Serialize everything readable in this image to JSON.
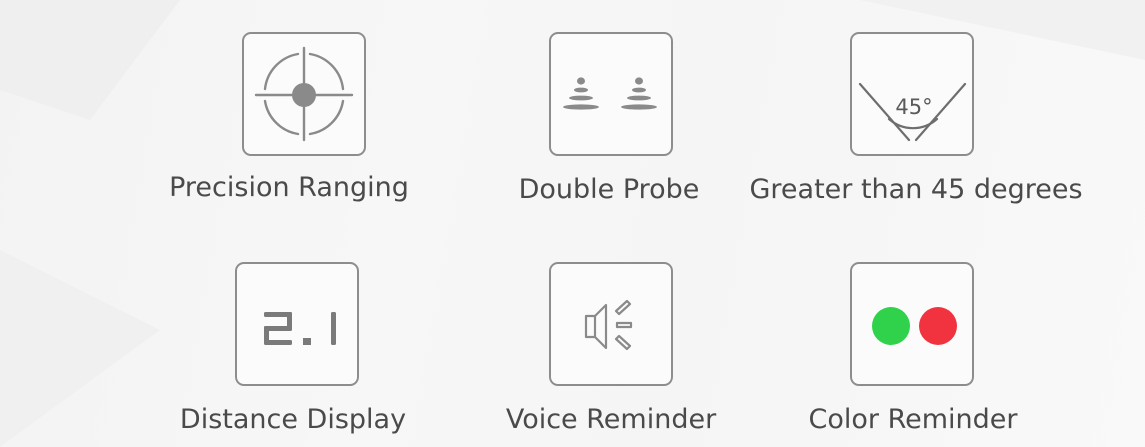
{
  "features": [
    {
      "label": "Precision Ranging",
      "icon": "crosshair-icon"
    },
    {
      "label": "Double Probe",
      "icon": "double-probe-icon"
    },
    {
      "label": "Greater than 45 degrees",
      "icon": "angle-45-icon",
      "icon_text": "45°"
    },
    {
      "label": "Distance Display",
      "icon": "digital-display-icon",
      "icon_text": "2.1"
    },
    {
      "label": "Voice Reminder",
      "icon": "speaker-icon"
    },
    {
      "label": "Color Reminder",
      "icon": "color-dots-icon",
      "colors": [
        "#2fd24a",
        "#f0333f"
      ]
    }
  ]
}
